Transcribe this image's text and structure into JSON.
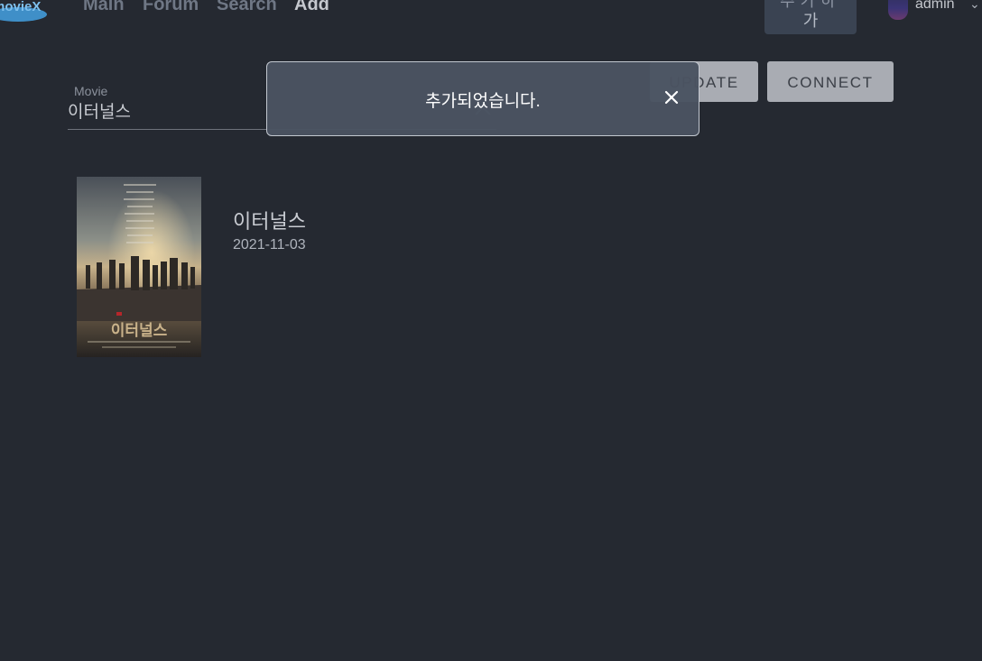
{
  "header": {
    "logo_text": "movieX",
    "nav": [
      {
        "label": "Main",
        "active": false
      },
      {
        "label": "Forum",
        "active": false
      },
      {
        "label": "Search",
        "active": false
      },
      {
        "label": "Add",
        "active": true
      }
    ],
    "add_button": {
      "line1": "추가하",
      "line2": "가"
    },
    "user": {
      "name": "admin"
    }
  },
  "form": {
    "movie_label": "Movie",
    "movie_value": "이터널스"
  },
  "actions": {
    "update_label": "UPDATE",
    "connect_label": "CONNECT"
  },
  "movie": {
    "title": "이터널스",
    "release_date": "2021-11-03",
    "poster_title": "이터널스"
  },
  "toast": {
    "message": "추가되었습니다.",
    "close_label": "×"
  },
  "colors": {
    "background": "#252931",
    "button": "#a9acb3",
    "toast_bg": "#4a5361",
    "nav_inactive": "#6f7785"
  },
  "icons": {
    "logo": "moviex-logo",
    "chevron": "chevron-up-icon",
    "close": "close-icon",
    "caret": "chevron-down-icon"
  }
}
